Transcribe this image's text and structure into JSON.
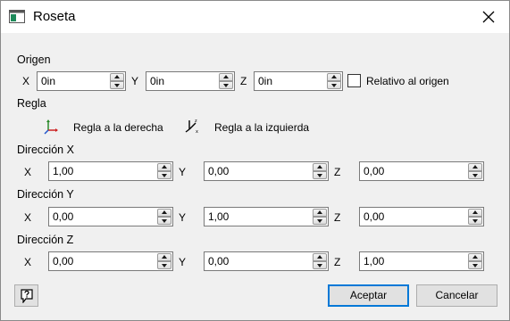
{
  "window": {
    "title": "Roseta",
    "colors": {
      "title_bg": "#ffffff",
      "body_bg": "#f0f0f0",
      "accent": "#0078d7"
    }
  },
  "origin": {
    "header": "Origen",
    "x_label": "X",
    "x_value": "0in",
    "y_label": "Y",
    "y_value": "0in",
    "z_label": "Z",
    "z_value": "0in",
    "relative_label": "Relativo al origen",
    "relative_checked": false
  },
  "rule": {
    "header": "Regla",
    "right_label": "Regla a la derecha",
    "left_label": "Regla a la izquierda",
    "right_icon": "right-hand-axes-icon",
    "left_icon": "left-hand-axes-icon"
  },
  "dir_x": {
    "header": "Dirección X",
    "x_label": "X",
    "x_value": "1,00",
    "y_label": "Y",
    "y_value": "0,00",
    "z_label": "Z",
    "z_value": "0,00"
  },
  "dir_y": {
    "header": "Dirección Y",
    "x_label": "X",
    "x_value": "0,00",
    "y_label": "Y",
    "y_value": "1,00",
    "z_label": "Z",
    "z_value": "0,00"
  },
  "dir_z": {
    "header": "Dirección Z",
    "x_label": "X",
    "x_value": "0,00",
    "y_label": "Y",
    "y_value": "0,00",
    "z_label": "Z",
    "z_value": "1,00"
  },
  "footer": {
    "help_icon": "help-icon",
    "accept_label": "Aceptar",
    "cancel_label": "Cancelar"
  }
}
